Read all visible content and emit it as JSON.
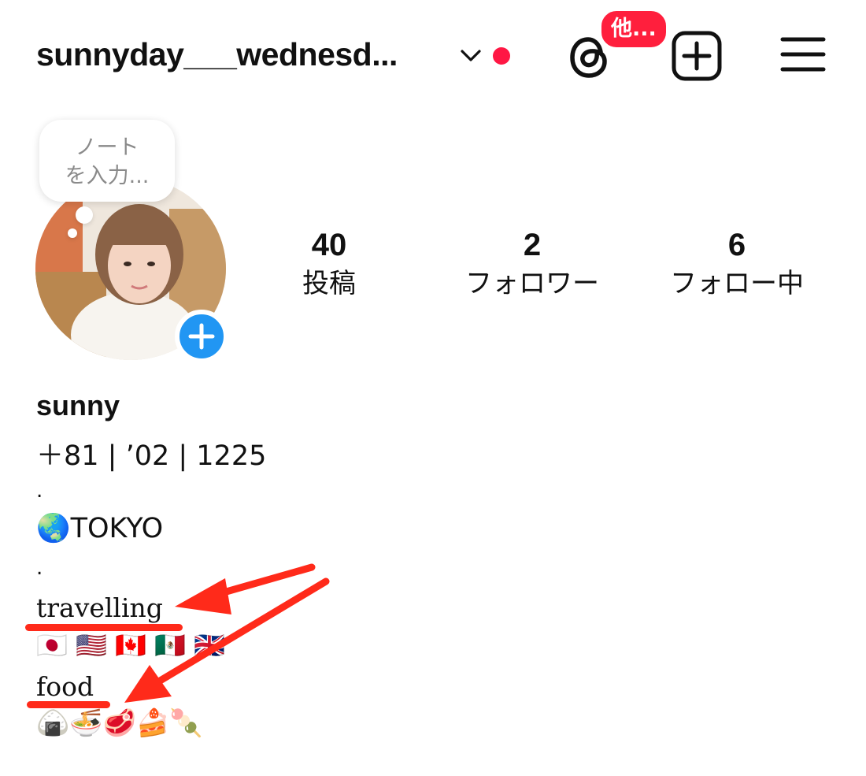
{
  "header": {
    "username": "sunnyday___wednesd...",
    "threads_badge": "他...",
    "colors": {
      "notification_dot": "#ff1744",
      "badge": "#ff1f3d"
    },
    "icons": [
      "chevron-down-icon",
      "threads-icon",
      "plus-square-icon",
      "hamburger-menu-icon"
    ]
  },
  "note": {
    "placeholder": "ノート\nを入力..."
  },
  "stats": {
    "posts": {
      "count": "40",
      "label": "投稿"
    },
    "followers": {
      "count": "2",
      "label": "フォロワー"
    },
    "following": {
      "count": "6",
      "label": "フォロー中"
    }
  },
  "profile": {
    "display_name": "sunny",
    "bio": [
      "＋81 | ’02 | 1225",
      ".",
      "🌏TOKYO",
      ".",
      "travelling",
      "🇯🇵 🇺🇸 🇨🇦 🇲🇽 🇬🇧",
      "food",
      "🍙🍜🥩🍰🍡"
    ]
  },
  "annotations": {
    "color": "#ff2a1a"
  }
}
